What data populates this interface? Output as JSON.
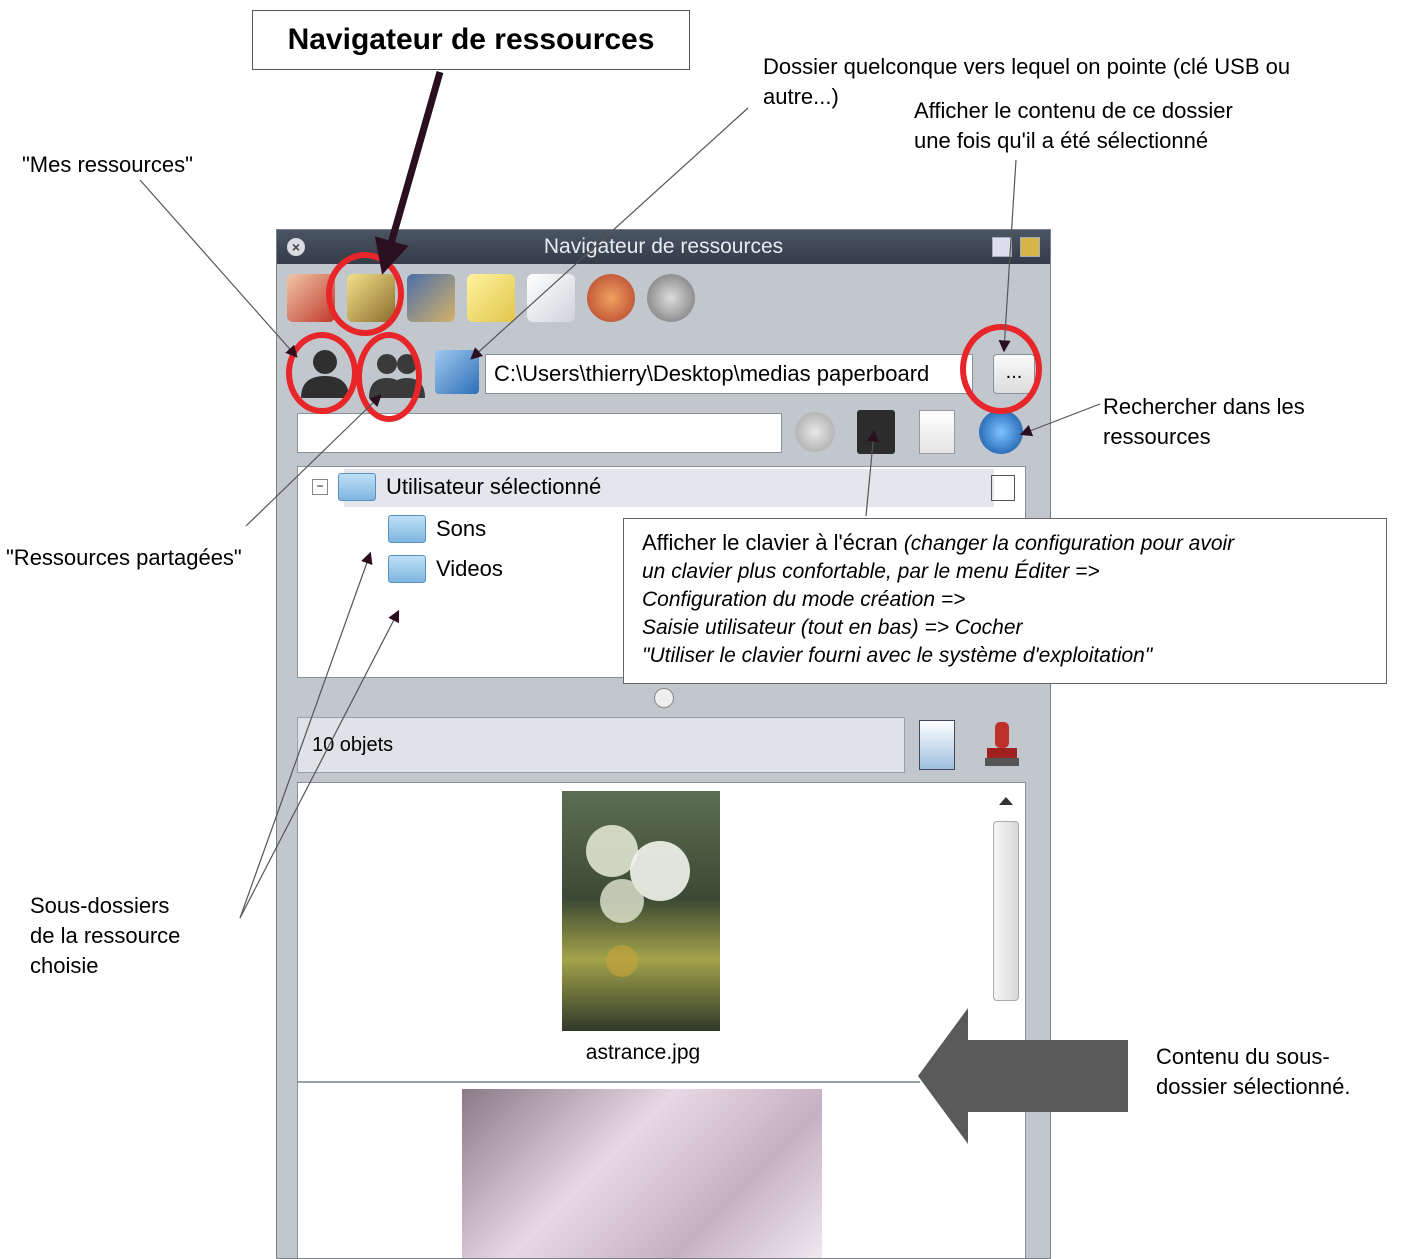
{
  "annotations": {
    "title_box": "Navigateur de ressources",
    "dossier_note_line1": "Dossier quelconque vers lequel on pointe (clé USB ou",
    "dossier_note_line2": "autre...)",
    "afficher_note_line1": "Afficher le contenu de ce dossier",
    "afficher_note_line2": "une fois qu'il a été sélectionné",
    "mes_ressources": "\"Mes ressources\"",
    "rechercher_line1": "Rechercher dans les",
    "rechercher_line2": "ressources",
    "ressources_partagees": "\"Ressources partagées\"",
    "keyboard_main": "Afficher le clavier à l'écran ",
    "keyboard_italic1": "(changer la configuration pour avoir",
    "keyboard_italic2": "un clavier plus confortable, par le menu Éditer =>",
    "keyboard_italic3": "Configuration du mode création =>",
    "keyboard_italic4": "Saisie utilisateur (tout en bas) => Cocher",
    "keyboard_italic5": "\"Utiliser le clavier fourni avec le système d'exploitation\"",
    "sous_dossiers_line1": "Sous-dossiers",
    "sous_dossiers_line2": "de la ressource",
    "sous_dossiers_line3": "choisie",
    "contenu_line1": "Contenu du sous-",
    "contenu_line2": "dossier sélectionné."
  },
  "window": {
    "title": "Navigateur de ressources",
    "path_value": "C:\\Users\\thierry\\Desktop\\medias paperboard",
    "browse_button": "...",
    "tree": {
      "root": "Utilisateur sélectionné",
      "children": [
        "Sons",
        "Videos"
      ]
    },
    "count": "10 objets",
    "items": [
      {
        "filename": "astrance.jpg"
      }
    ]
  },
  "colors": {
    "highlight": "#e8262a",
    "arrow": "#2b0f1e",
    "big_arrow": "#5a5a5a"
  }
}
